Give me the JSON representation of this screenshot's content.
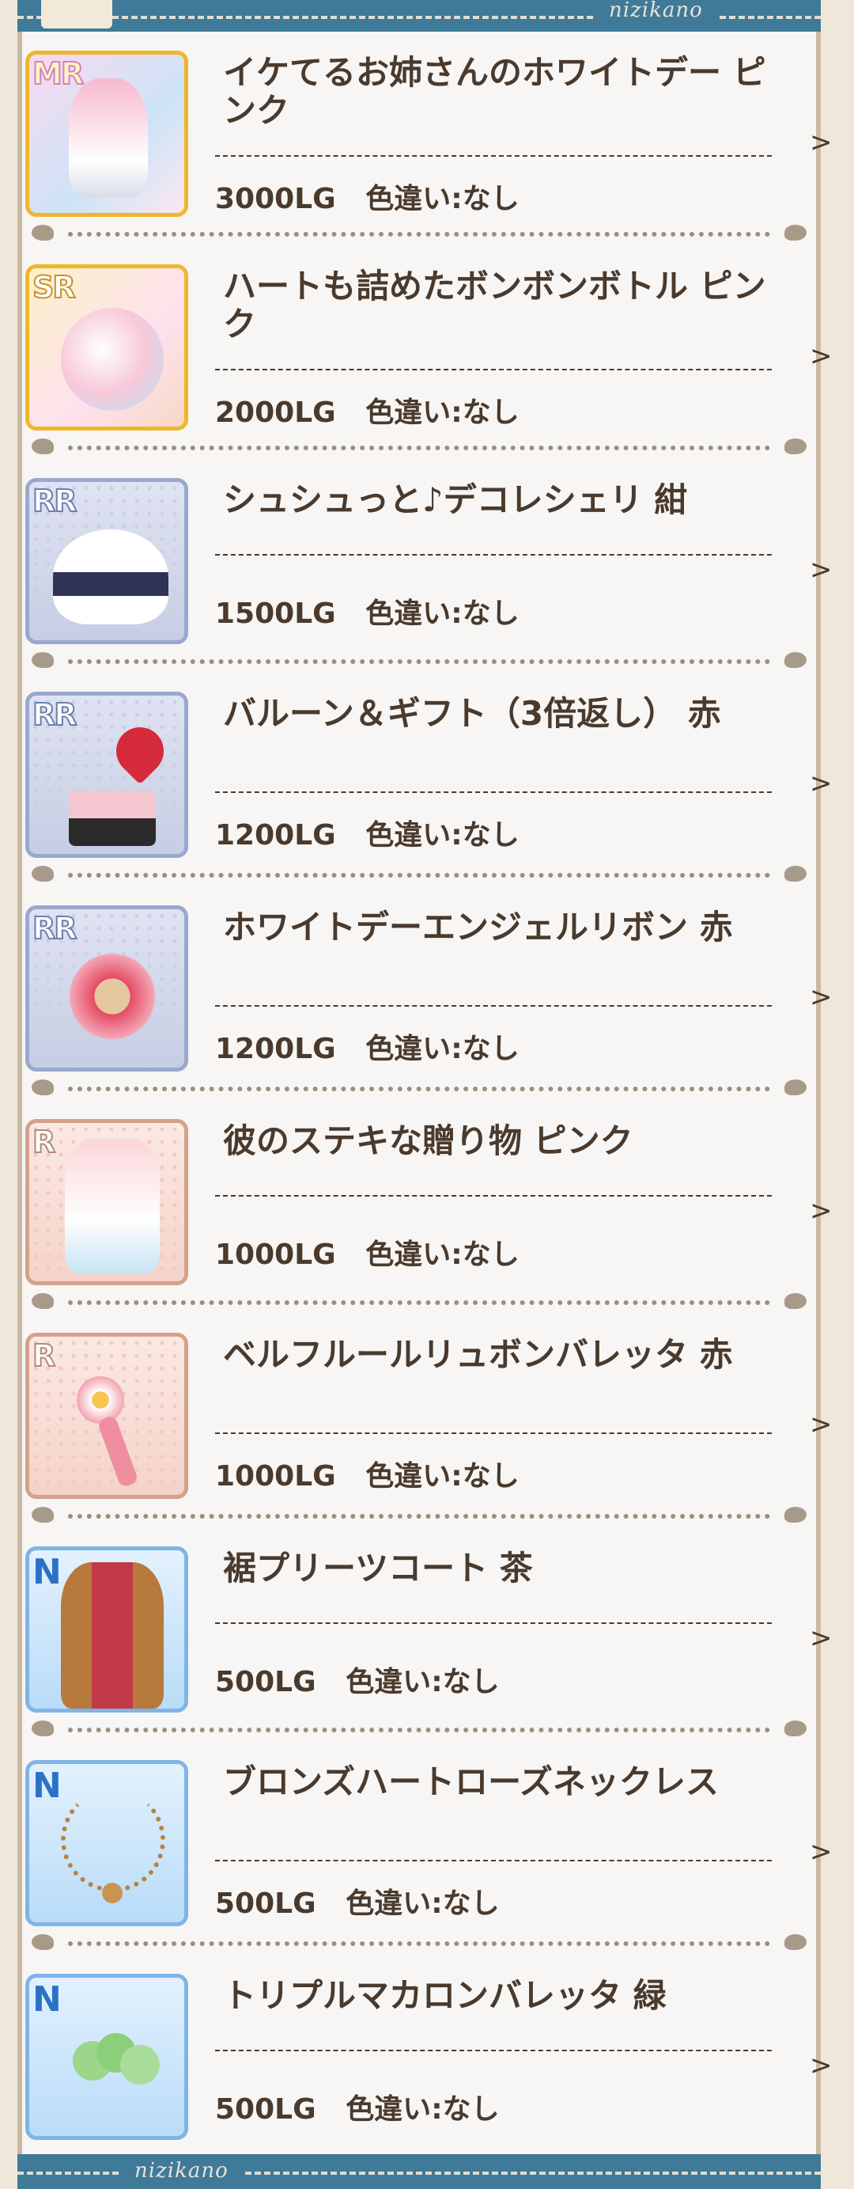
{
  "header": {
    "brand": "nizikano"
  },
  "footer": {
    "brand": "nizikano"
  },
  "items": [
    {
      "rarity": "MR",
      "name": "イケてるお姉さんのホワイトデー ピンク",
      "price": "3000LG",
      "variant_label": "色違い:なし",
      "icon": "outfit-pink-icon"
    },
    {
      "rarity": "SR",
      "name": "ハートも詰めたボンボンボトル ピンク",
      "price": "2000LG",
      "variant_label": "色違い:なし",
      "icon": "bonbon-bottle-icon"
    },
    {
      "rarity": "RR",
      "name": "シュシュっと♪デコレシェリ 紺",
      "price": "1500LG",
      "variant_label": "色違い:なし",
      "icon": "dress-navy-icon"
    },
    {
      "rarity": "RR",
      "name": "バルーン＆ギフト（3倍返し） 赤",
      "price": "1200LG",
      "variant_label": "色違い:なし",
      "icon": "balloon-gift-icon"
    },
    {
      "rarity": "RR",
      "name": "ホワイトデーエンジェルリボン 赤",
      "price": "1200LG",
      "variant_label": "色違い:なし",
      "icon": "angel-ribbon-icon"
    },
    {
      "rarity": "R",
      "name": "彼のステキな贈り物 ピンク",
      "price": "1000LG",
      "variant_label": "色違い:なし",
      "icon": "cardigan-pink-icon"
    },
    {
      "rarity": "R",
      "name": "ベルフルールリュボンバレッタ 赤",
      "price": "1000LG",
      "variant_label": "色違い:なし",
      "icon": "flower-barrette-icon"
    },
    {
      "rarity": "N",
      "name": "裾プリーツコート 茶",
      "price": "500LG",
      "variant_label": "色違い:なし",
      "icon": "coat-brown-icon"
    },
    {
      "rarity": "N",
      "name": "ブロンズハートローズネックレス",
      "price": "500LG",
      "variant_label": "色違い:なし",
      "icon": "necklace-icon"
    },
    {
      "rarity": "N",
      "name": "トリプルマカロンバレッタ 緑",
      "price": "500LG",
      "variant_label": "色違い:なし",
      "icon": "macaron-barrette-icon"
    }
  ],
  "arrow_glyph": ">"
}
